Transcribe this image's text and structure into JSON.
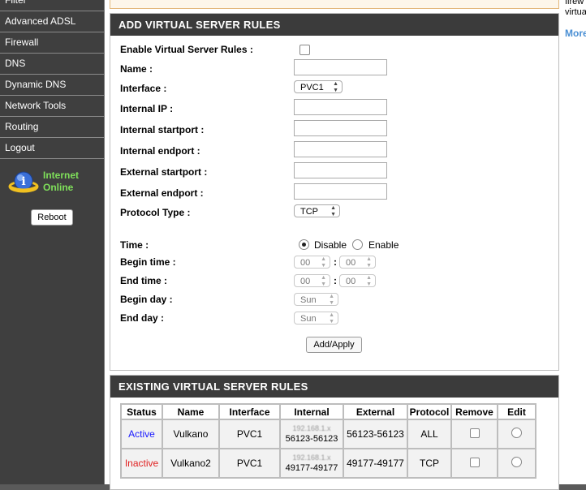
{
  "nav": {
    "items": [
      "Filter",
      "Advanced ADSL",
      "Firewall",
      "DNS",
      "Dynamic DNS",
      "Network Tools",
      "Routing",
      "Logout"
    ],
    "status_line1": "Internet",
    "status_line2": "Online",
    "reboot_label": "Reboot"
  },
  "add_form": {
    "header": "ADD VIRTUAL SERVER RULES",
    "labels": {
      "enable": "Enable Virtual Server Rules :",
      "name": "Name :",
      "interface": "Interface :",
      "internal_ip": "Internal IP :",
      "internal_start": "Internal startport :",
      "internal_end": "Internal endport :",
      "external_start": "External startport :",
      "external_end": "External endport :",
      "protocol": "Protocol Type :",
      "time": "Time :",
      "begin_time": "Begin time :",
      "end_time": "End time :",
      "begin_day": "Begin day :",
      "end_day": "End day :"
    },
    "interface_value": "PVC1",
    "protocol_value": "TCP",
    "time_disable": "Disable",
    "time_enable": "Enable",
    "time_selected": "Disable",
    "begin_hour": "00",
    "begin_min": "00",
    "end_hour": "00",
    "end_min": "00",
    "begin_day_value": "Sun",
    "end_day_value": "Sun",
    "apply_label": "Add/Apply"
  },
  "existing": {
    "header": "EXISTING VIRTUAL SERVER RULES",
    "columns": [
      "Status",
      "Name",
      "Interface",
      "Internal",
      "External",
      "Protocol",
      "Remove",
      "Edit"
    ],
    "rows": [
      {
        "status": "Active",
        "status_color": "#1a1aff",
        "name": "Vulkano",
        "interface": "PVC1",
        "internal_ports": "56123-56123",
        "external": "56123-56123",
        "protocol": "ALL"
      },
      {
        "status": "Inactive",
        "status_color": "#e02020",
        "name": "Vulkano2",
        "interface": "PVC1",
        "internal_ports": "49177-49177",
        "external": "49177-49177",
        "protocol": "TCP"
      }
    ]
  },
  "right_panel": {
    "line1": "firew",
    "line2": "virtua",
    "more": "More"
  }
}
